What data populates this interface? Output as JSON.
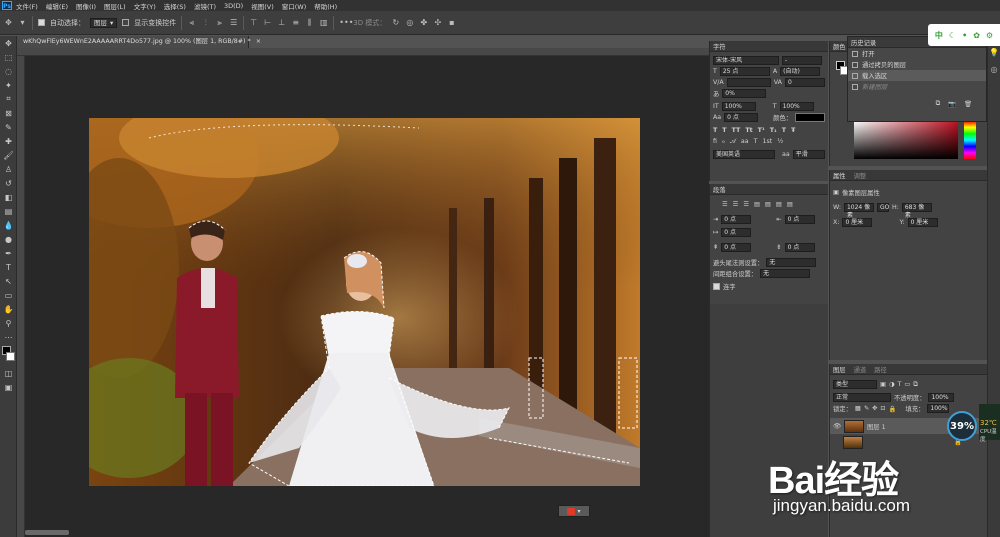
{
  "menubar": {
    "logo": "Ps",
    "items": [
      "文件(F)",
      "编辑(E)",
      "图像(I)",
      "图层(L)",
      "文字(Y)",
      "选择(S)",
      "滤镜(T)",
      "3D(D)",
      "视图(V)",
      "窗口(W)",
      "帮助(H)"
    ]
  },
  "options": {
    "auto_select_label": "自动选择：",
    "auto_select_value": "图层",
    "show_transform_label": "显示变换控件",
    "mode_3d": "3D 模式："
  },
  "document": {
    "tab_title": "wKhQwFlEy6WEWnE2AAAAARRT4Do577.jpg @ 100% (图层 1, RGB/8#) *",
    "close": "×"
  },
  "character_panel": {
    "tab": "字符",
    "font_family": "宋体-宋风",
    "font_style": "-",
    "font_size": "25 点",
    "leading": "(自动)",
    "tracking_label": "V/A",
    "tracking": "0",
    "kerning_value": "0%",
    "vscale": "100%",
    "hscale": "100%",
    "baseline": "0 点",
    "color_label": "颜色：",
    "language": "美国英语",
    "antialias_label": "aa",
    "antialias": "平滑"
  },
  "paragraph_panel": {
    "tab": "段落",
    "indent_left": "0 点",
    "indent_right": "0 点",
    "indent_first": "0 点",
    "space_before": "0 点",
    "space_after": "0 点",
    "avoid_label": "避头尾法则设置：",
    "avoid_value": "无",
    "spacing_label": "间距组合设置：",
    "spacing_value": "无",
    "hyphen_label": "连字"
  },
  "color_panel": {
    "tab": "颜色"
  },
  "history_panel": {
    "tab": "历史记录",
    "items": [
      {
        "label": "打开",
        "state": "normal"
      },
      {
        "label": "通过拷贝的图层",
        "state": "normal"
      },
      {
        "label": "载入选区",
        "state": "active"
      },
      {
        "label": "新建图层",
        "state": "dim"
      }
    ]
  },
  "properties_panel": {
    "tabs": [
      "属性",
      "调整"
    ],
    "title": "像素图层属性",
    "w_label": "W:",
    "w_value": "1024 像素",
    "link": "GO",
    "h_label": "H:",
    "h_value": "683 像素",
    "x_label": "X:",
    "x_value": "0 厘米",
    "y_label": "Y:",
    "y_value": "0 厘米"
  },
  "layers_panel": {
    "tabs": [
      "图层",
      "通道",
      "路径"
    ],
    "filter": "类型",
    "blend_mode": "正常",
    "opacity_label": "不透明度：",
    "opacity": "100%",
    "lock_label": "锁定：",
    "fill_label": "填充：",
    "fill": "100%",
    "layers": [
      {
        "name": "图层 1"
      }
    ]
  },
  "overlay": {
    "brand_text": "中",
    "cpu_percent": "39%",
    "cpu_temp": "32℃",
    "cpu_label": "CPU温度",
    "baidu_logo": "Bai经验",
    "baidu_url": "jingyan.baidu.com"
  },
  "colors": {
    "accent": "#31a8ff",
    "panel_bg": "#434343",
    "canvas_bg": "#282828"
  }
}
